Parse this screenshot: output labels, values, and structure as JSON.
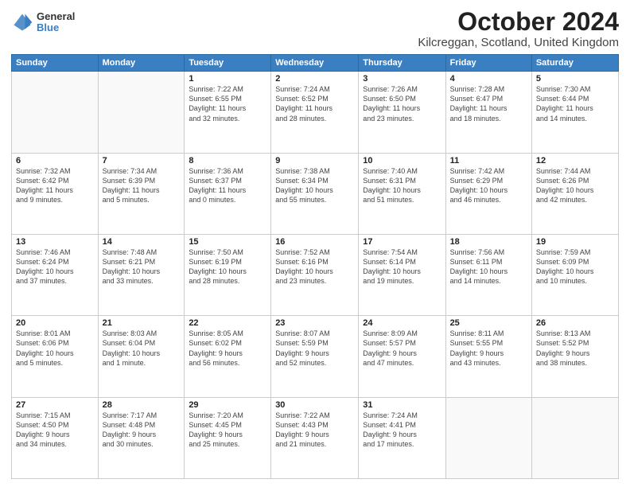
{
  "logo": {
    "general": "General",
    "blue": "Blue"
  },
  "title": "October 2024",
  "subtitle": "Kilcreggan, Scotland, United Kingdom",
  "headers": [
    "Sunday",
    "Monday",
    "Tuesday",
    "Wednesday",
    "Thursday",
    "Friday",
    "Saturday"
  ],
  "weeks": [
    [
      {
        "num": "",
        "info": ""
      },
      {
        "num": "",
        "info": ""
      },
      {
        "num": "1",
        "info": "Sunrise: 7:22 AM\nSunset: 6:55 PM\nDaylight: 11 hours\nand 32 minutes."
      },
      {
        "num": "2",
        "info": "Sunrise: 7:24 AM\nSunset: 6:52 PM\nDaylight: 11 hours\nand 28 minutes."
      },
      {
        "num": "3",
        "info": "Sunrise: 7:26 AM\nSunset: 6:50 PM\nDaylight: 11 hours\nand 23 minutes."
      },
      {
        "num": "4",
        "info": "Sunrise: 7:28 AM\nSunset: 6:47 PM\nDaylight: 11 hours\nand 18 minutes."
      },
      {
        "num": "5",
        "info": "Sunrise: 7:30 AM\nSunset: 6:44 PM\nDaylight: 11 hours\nand 14 minutes."
      }
    ],
    [
      {
        "num": "6",
        "info": "Sunrise: 7:32 AM\nSunset: 6:42 PM\nDaylight: 11 hours\nand 9 minutes."
      },
      {
        "num": "7",
        "info": "Sunrise: 7:34 AM\nSunset: 6:39 PM\nDaylight: 11 hours\nand 5 minutes."
      },
      {
        "num": "8",
        "info": "Sunrise: 7:36 AM\nSunset: 6:37 PM\nDaylight: 11 hours\nand 0 minutes."
      },
      {
        "num": "9",
        "info": "Sunrise: 7:38 AM\nSunset: 6:34 PM\nDaylight: 10 hours\nand 55 minutes."
      },
      {
        "num": "10",
        "info": "Sunrise: 7:40 AM\nSunset: 6:31 PM\nDaylight: 10 hours\nand 51 minutes."
      },
      {
        "num": "11",
        "info": "Sunrise: 7:42 AM\nSunset: 6:29 PM\nDaylight: 10 hours\nand 46 minutes."
      },
      {
        "num": "12",
        "info": "Sunrise: 7:44 AM\nSunset: 6:26 PM\nDaylight: 10 hours\nand 42 minutes."
      }
    ],
    [
      {
        "num": "13",
        "info": "Sunrise: 7:46 AM\nSunset: 6:24 PM\nDaylight: 10 hours\nand 37 minutes."
      },
      {
        "num": "14",
        "info": "Sunrise: 7:48 AM\nSunset: 6:21 PM\nDaylight: 10 hours\nand 33 minutes."
      },
      {
        "num": "15",
        "info": "Sunrise: 7:50 AM\nSunset: 6:19 PM\nDaylight: 10 hours\nand 28 minutes."
      },
      {
        "num": "16",
        "info": "Sunrise: 7:52 AM\nSunset: 6:16 PM\nDaylight: 10 hours\nand 23 minutes."
      },
      {
        "num": "17",
        "info": "Sunrise: 7:54 AM\nSunset: 6:14 PM\nDaylight: 10 hours\nand 19 minutes."
      },
      {
        "num": "18",
        "info": "Sunrise: 7:56 AM\nSunset: 6:11 PM\nDaylight: 10 hours\nand 14 minutes."
      },
      {
        "num": "19",
        "info": "Sunrise: 7:59 AM\nSunset: 6:09 PM\nDaylight: 10 hours\nand 10 minutes."
      }
    ],
    [
      {
        "num": "20",
        "info": "Sunrise: 8:01 AM\nSunset: 6:06 PM\nDaylight: 10 hours\nand 5 minutes."
      },
      {
        "num": "21",
        "info": "Sunrise: 8:03 AM\nSunset: 6:04 PM\nDaylight: 10 hours\nand 1 minute."
      },
      {
        "num": "22",
        "info": "Sunrise: 8:05 AM\nSunset: 6:02 PM\nDaylight: 9 hours\nand 56 minutes."
      },
      {
        "num": "23",
        "info": "Sunrise: 8:07 AM\nSunset: 5:59 PM\nDaylight: 9 hours\nand 52 minutes."
      },
      {
        "num": "24",
        "info": "Sunrise: 8:09 AM\nSunset: 5:57 PM\nDaylight: 9 hours\nand 47 minutes."
      },
      {
        "num": "25",
        "info": "Sunrise: 8:11 AM\nSunset: 5:55 PM\nDaylight: 9 hours\nand 43 minutes."
      },
      {
        "num": "26",
        "info": "Sunrise: 8:13 AM\nSunset: 5:52 PM\nDaylight: 9 hours\nand 38 minutes."
      }
    ],
    [
      {
        "num": "27",
        "info": "Sunrise: 7:15 AM\nSunset: 4:50 PM\nDaylight: 9 hours\nand 34 minutes."
      },
      {
        "num": "28",
        "info": "Sunrise: 7:17 AM\nSunset: 4:48 PM\nDaylight: 9 hours\nand 30 minutes."
      },
      {
        "num": "29",
        "info": "Sunrise: 7:20 AM\nSunset: 4:45 PM\nDaylight: 9 hours\nand 25 minutes."
      },
      {
        "num": "30",
        "info": "Sunrise: 7:22 AM\nSunset: 4:43 PM\nDaylight: 9 hours\nand 21 minutes."
      },
      {
        "num": "31",
        "info": "Sunrise: 7:24 AM\nSunset: 4:41 PM\nDaylight: 9 hours\nand 17 minutes."
      },
      {
        "num": "",
        "info": ""
      },
      {
        "num": "",
        "info": ""
      }
    ]
  ]
}
